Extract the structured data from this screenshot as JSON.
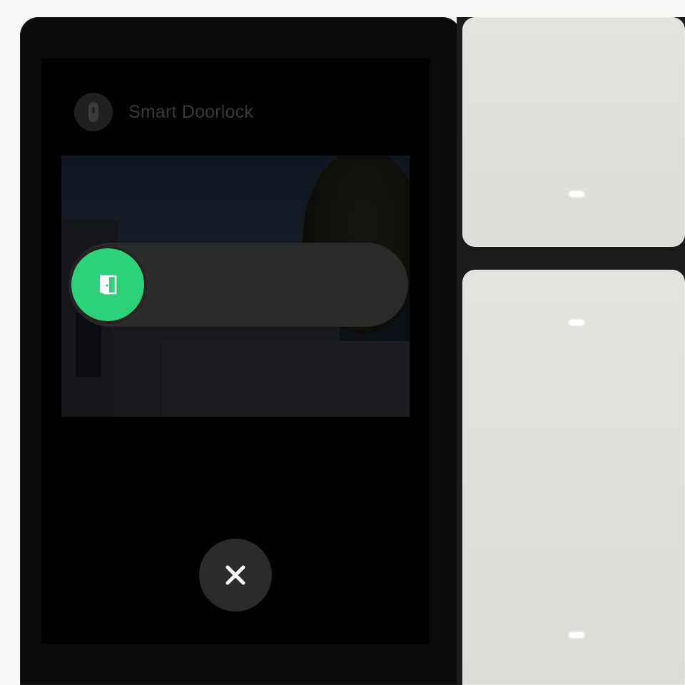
{
  "header": {
    "title": "Smart Doorlock",
    "icon": "doorlock-icon"
  },
  "slider": {
    "knob_icon": "door-open-icon",
    "accent_color": "#2dd17a"
  },
  "close_button": {
    "icon": "close-icon"
  },
  "switches": [
    {
      "name": "top-switch",
      "indicator": "led-indicator"
    },
    {
      "name": "bottom-switch",
      "indicators": [
        "led-indicator",
        "led-indicator"
      ]
    }
  ]
}
